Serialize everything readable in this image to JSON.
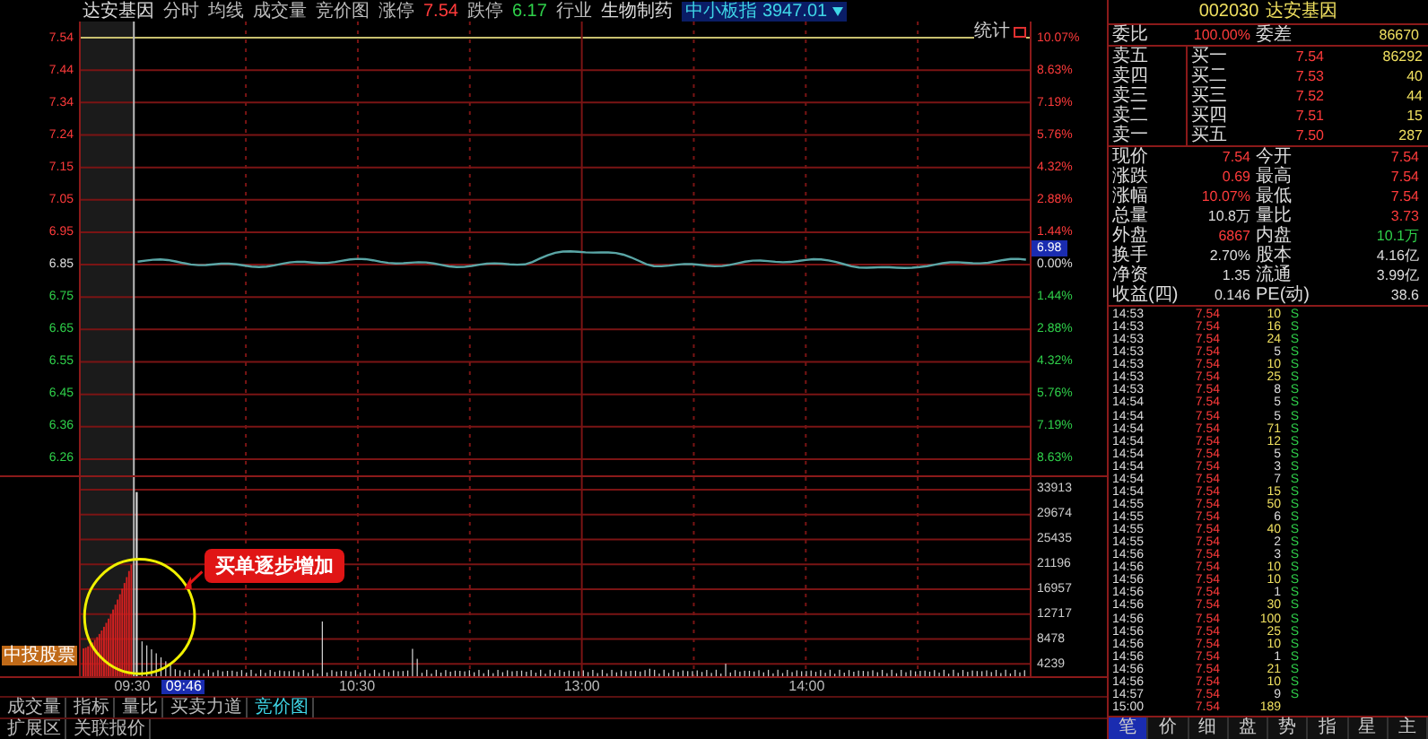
{
  "header": {
    "title": "达安基因",
    "tabs": [
      {
        "label": "分时"
      },
      {
        "label": "均线"
      },
      {
        "label": "成交量"
      },
      {
        "label": "竞价图"
      }
    ],
    "stats": [
      {
        "label": "涨停",
        "value": "7.54",
        "kind": "up"
      },
      {
        "label": "跌停",
        "value": "6.17",
        "kind": "down"
      },
      {
        "label": "行业",
        "value": "生物制药",
        "kind": "flat"
      }
    ],
    "index": {
      "name": "中小板指",
      "value": "3947.01"
    }
  },
  "chart": {
    "stat_button": "统计",
    "price_axis": [
      {
        "label": "7.54",
        "kind": "up"
      },
      {
        "label": "7.44",
        "kind": "up"
      },
      {
        "label": "7.34",
        "kind": "up"
      },
      {
        "label": "7.24",
        "kind": "up"
      },
      {
        "label": "7.15",
        "kind": "up"
      },
      {
        "label": "7.05",
        "kind": "up"
      },
      {
        "label": "6.95",
        "kind": "up"
      },
      {
        "label": "6.85",
        "kind": "flat"
      },
      {
        "label": "6.75",
        "kind": "down"
      },
      {
        "label": "6.65",
        "kind": "down"
      },
      {
        "label": "6.55",
        "kind": "down"
      },
      {
        "label": "6.45",
        "kind": "down"
      },
      {
        "label": "6.36",
        "kind": "down"
      },
      {
        "label": "6.26",
        "kind": "down"
      }
    ],
    "percent_axis": [
      {
        "label": "10.07%",
        "kind": "up"
      },
      {
        "label": "8.63%",
        "kind": "up"
      },
      {
        "label": "7.19%",
        "kind": "up"
      },
      {
        "label": "5.76%",
        "kind": "up"
      },
      {
        "label": "4.32%",
        "kind": "up"
      },
      {
        "label": "2.88%",
        "kind": "up"
      },
      {
        "label": "1.44%",
        "kind": "up"
      },
      {
        "label": "0.00%",
        "kind": "flat"
      },
      {
        "label": "1.44%",
        "kind": "down"
      },
      {
        "label": "2.88%",
        "kind": "down"
      },
      {
        "label": "4.32%",
        "kind": "down"
      },
      {
        "label": "5.76%",
        "kind": "down"
      },
      {
        "label": "7.19%",
        "kind": "down"
      },
      {
        "label": "8.63%",
        "kind": "down"
      }
    ],
    "volume_axis": [
      "33913",
      "29674",
      "25435",
      "21196",
      "16957",
      "12717",
      "8478",
      "4239"
    ],
    "cursor_price": "6.98",
    "cursor_time": "09:46",
    "time_axis": [
      "09:30",
      "10:30",
      "13:00",
      "14:00"
    ],
    "auction_tag": "中投股票",
    "annotation": "买单逐步增加"
  },
  "footer": {
    "tabs": [
      {
        "label": "成交量",
        "selected": false
      },
      {
        "label": "指标",
        "selected": false
      },
      {
        "label": "量比",
        "selected": false
      },
      {
        "label": "买卖力道",
        "selected": false
      },
      {
        "label": "竞价图",
        "selected": true
      }
    ],
    "extra_tabs": [
      "扩展区",
      "关联报价"
    ]
  },
  "panel": {
    "code": "002030",
    "name": "达安基因",
    "ratio": {
      "label": "委比",
      "value": "100.00%",
      "label2": "委差",
      "value2": "86670"
    },
    "asks": [
      {
        "label": "卖五"
      },
      {
        "label": "卖四"
      },
      {
        "label": "卖三"
      },
      {
        "label": "卖二"
      },
      {
        "label": "卖一"
      }
    ],
    "bids": [
      {
        "label": "买一",
        "price": "7.54",
        "volume": "86292"
      },
      {
        "label": "买二",
        "price": "7.53",
        "volume": "40"
      },
      {
        "label": "买三",
        "price": "7.52",
        "volume": "44"
      },
      {
        "label": "买四",
        "price": "7.51",
        "volume": "15"
      },
      {
        "label": "买五",
        "price": "7.50",
        "volume": "287"
      }
    ],
    "quotes": [
      {
        "label": "现价",
        "value": "7.54",
        "kind": "up"
      },
      {
        "label": "今开",
        "value": "7.54",
        "kind": "up"
      },
      {
        "label": "涨跌",
        "value": "0.69",
        "kind": "up"
      },
      {
        "label": "最高",
        "value": "7.54",
        "kind": "up"
      },
      {
        "label": "涨幅",
        "value": "10.07%",
        "kind": "up"
      },
      {
        "label": "最低",
        "value": "7.54",
        "kind": "up"
      },
      {
        "label": "总量",
        "value": "10.8万",
        "kind": "flat"
      },
      {
        "label": "量比",
        "value": "3.73",
        "kind": "up"
      },
      {
        "label": "外盘",
        "value": "6867",
        "kind": "up"
      },
      {
        "label": "内盘",
        "value": "10.1万",
        "kind": "down"
      },
      {
        "label": "换手",
        "value": "2.70%",
        "kind": "flat"
      },
      {
        "label": "股本",
        "value": "4.16亿",
        "kind": "flat"
      },
      {
        "label": "净资",
        "value": "1.35",
        "kind": "flat"
      },
      {
        "label": "流通",
        "value": "3.99亿",
        "kind": "flat"
      },
      {
        "label": "收益(四)",
        "value": "0.146",
        "kind": "flat"
      },
      {
        "label": "PE(动)",
        "value": "38.6",
        "kind": "flat"
      }
    ],
    "trades": [
      {
        "time": "14:53",
        "price": "7.54",
        "volume": "10",
        "side": "S",
        "large": true
      },
      {
        "time": "14:53",
        "price": "7.54",
        "volume": "16",
        "side": "S",
        "large": true
      },
      {
        "time": "14:53",
        "price": "7.54",
        "volume": "24",
        "side": "S",
        "large": true
      },
      {
        "time": "14:53",
        "price": "7.54",
        "volume": "5",
        "side": "S",
        "large": false
      },
      {
        "time": "14:53",
        "price": "7.54",
        "volume": "10",
        "side": "S",
        "large": true
      },
      {
        "time": "14:53",
        "price": "7.54",
        "volume": "25",
        "side": "S",
        "large": true
      },
      {
        "time": "14:53",
        "price": "7.54",
        "volume": "8",
        "side": "S",
        "large": false
      },
      {
        "time": "14:54",
        "price": "7.54",
        "volume": "5",
        "side": "S",
        "large": false
      },
      {
        "time": "14:54",
        "price": "7.54",
        "volume": "5",
        "side": "S",
        "large": false
      },
      {
        "time": "14:54",
        "price": "7.54",
        "volume": "71",
        "side": "S",
        "large": true
      },
      {
        "time": "14:54",
        "price": "7.54",
        "volume": "12",
        "side": "S",
        "large": true
      },
      {
        "time": "14:54",
        "price": "7.54",
        "volume": "5",
        "side": "S",
        "large": false
      },
      {
        "time": "14:54",
        "price": "7.54",
        "volume": "3",
        "side": "S",
        "large": false
      },
      {
        "time": "14:54",
        "price": "7.54",
        "volume": "7",
        "side": "S",
        "large": false
      },
      {
        "time": "14:54",
        "price": "7.54",
        "volume": "15",
        "side": "S",
        "large": true
      },
      {
        "time": "14:55",
        "price": "7.54",
        "volume": "50",
        "side": "S",
        "large": true
      },
      {
        "time": "14:55",
        "price": "7.54",
        "volume": "6",
        "side": "S",
        "large": false
      },
      {
        "time": "14:55",
        "price": "7.54",
        "volume": "40",
        "side": "S",
        "large": true
      },
      {
        "time": "14:55",
        "price": "7.54",
        "volume": "2",
        "side": "S",
        "large": false
      },
      {
        "time": "14:56",
        "price": "7.54",
        "volume": "3",
        "side": "S",
        "large": false
      },
      {
        "time": "14:56",
        "price": "7.54",
        "volume": "10",
        "side": "S",
        "large": true
      },
      {
        "time": "14:56",
        "price": "7.54",
        "volume": "10",
        "side": "S",
        "large": true
      },
      {
        "time": "14:56",
        "price": "7.54",
        "volume": "1",
        "side": "S",
        "large": false
      },
      {
        "time": "14:56",
        "price": "7.54",
        "volume": "30",
        "side": "S",
        "large": true
      },
      {
        "time": "14:56",
        "price": "7.54",
        "volume": "100",
        "side": "S",
        "large": true
      },
      {
        "time": "14:56",
        "price": "7.54",
        "volume": "25",
        "side": "S",
        "large": true
      },
      {
        "time": "14:56",
        "price": "7.54",
        "volume": "10",
        "side": "S",
        "large": true
      },
      {
        "time": "14:56",
        "price": "7.54",
        "volume": "1",
        "side": "S",
        "large": false
      },
      {
        "time": "14:56",
        "price": "7.54",
        "volume": "21",
        "side": "S",
        "large": true
      },
      {
        "time": "14:56",
        "price": "7.54",
        "volume": "10",
        "side": "S",
        "large": true
      },
      {
        "time": "14:57",
        "price": "7.54",
        "volume": "9",
        "side": "S",
        "large": false
      },
      {
        "time": "15:00",
        "price": "7.54",
        "volume": "189",
        "large": true
      }
    ],
    "tabs": [
      {
        "label": "笔",
        "selected": true
      },
      {
        "label": "价",
        "selected": false
      },
      {
        "label": "细",
        "selected": false
      },
      {
        "label": "盘",
        "selected": false
      },
      {
        "label": "势",
        "selected": false
      },
      {
        "label": "指",
        "selected": false
      },
      {
        "label": "星",
        "selected": false
      },
      {
        "label": "主",
        "selected": false
      }
    ]
  }
}
